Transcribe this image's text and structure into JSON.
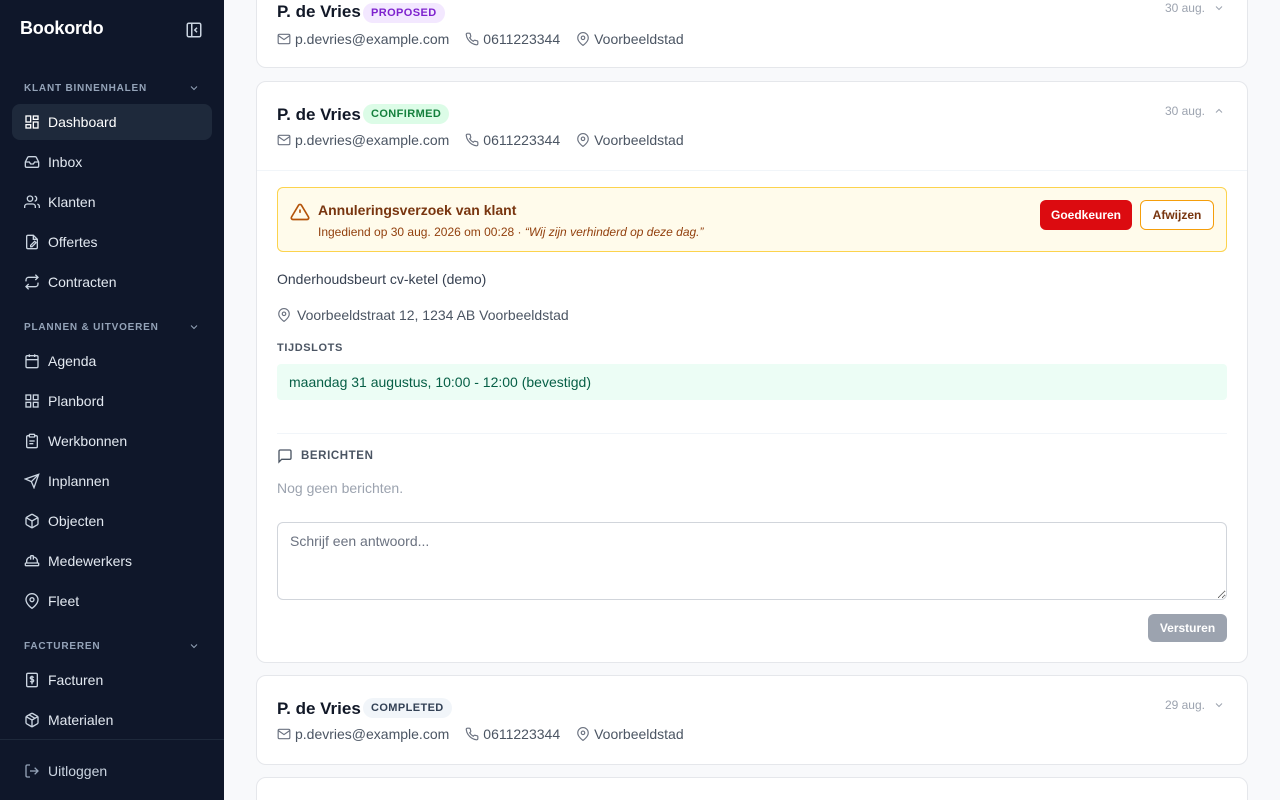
{
  "app": {
    "brand": "Bookordo"
  },
  "sidebar": {
    "sections": [
      {
        "title": "KLANT BINNENHALEN"
      },
      {
        "title": "PLANNEN & UITVOEREN"
      },
      {
        "title": "FACTUREREN"
      }
    ],
    "items": [
      {
        "label": "Dashboard",
        "icon": "dashboard-icon",
        "active": true
      },
      {
        "label": "Inbox",
        "icon": "inbox-icon"
      },
      {
        "label": "Klanten",
        "icon": "users-icon"
      },
      {
        "label": "Offertes",
        "icon": "edit-document-icon"
      },
      {
        "label": "Contracten",
        "icon": "repeat-icon"
      },
      {
        "label": "Agenda",
        "icon": "calendar-icon"
      },
      {
        "label": "Planbord",
        "icon": "grid-icon"
      },
      {
        "label": "Werkbonnen",
        "icon": "clipboard-icon"
      },
      {
        "label": "Inplannen",
        "icon": "send-icon"
      },
      {
        "label": "Objecten",
        "icon": "box-icon"
      },
      {
        "label": "Medewerkers",
        "icon": "hard-hat-icon"
      },
      {
        "label": "Fleet",
        "icon": "map-pin-icon"
      },
      {
        "label": "Facturen",
        "icon": "receipt-icon"
      },
      {
        "label": "Materialen",
        "icon": "package-icon"
      }
    ],
    "logout": "Uitloggen"
  },
  "cards": [
    {
      "name": "P. de Vries",
      "status": "PROPOSED",
      "email": "p.devries@example.com",
      "phone": "0611223344",
      "city": "Voorbeeldstad",
      "date": "30 aug."
    },
    {
      "name": "P. de Vries",
      "status": "CONFIRMED",
      "email": "p.devries@example.com",
      "phone": "0611223344",
      "city": "Voorbeeldstad",
      "date": "30 aug.",
      "alert": {
        "title": "Annuleringsverzoek van klant",
        "submitted": "Ingediend op 30 aug. 2026 om 00:28 · ",
        "quote": "“Wij zijn verhinderd op deze dag.”",
        "approve": "Goedkeuren",
        "reject": "Afwijzen"
      },
      "service": "Onderhoudsbeurt cv-ketel (demo)",
      "address": "Voorbeeldstraat 12, 1234 AB Voorbeeldstad",
      "timeslots_label": "TIJDSLOTS",
      "timeslot": "maandag 31 augustus, 10:00 - 12:00 (bevestigd)",
      "messages_label": "BERICHTEN",
      "no_messages": "Nog geen berichten.",
      "reply_placeholder": "Schrijf een antwoord...",
      "send": "Versturen"
    },
    {
      "name": "P. de Vries",
      "status": "COMPLETED",
      "email": "p.devries@example.com",
      "phone": "0611223344",
      "city": "Voorbeeldstad",
      "date": "29 aug."
    }
  ]
}
